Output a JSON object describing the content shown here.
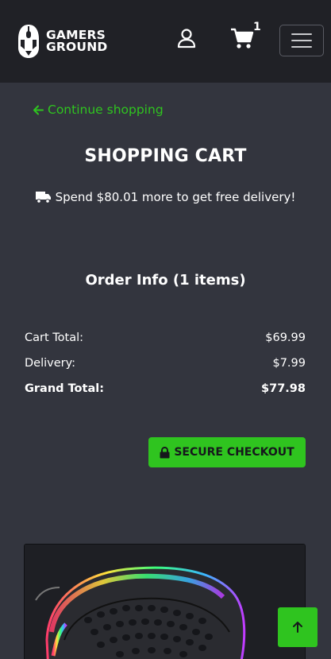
{
  "header": {
    "brand_line1": "GAMERS",
    "brand_line2": "GROUND",
    "cart_count": "1",
    "icons": [
      "mouse-logo-icon",
      "user-icon",
      "cart-icon",
      "hamburger-menu-icon"
    ]
  },
  "nav": {
    "continue_label": "Continue shopping"
  },
  "cart": {
    "title": "SHOPPING CART",
    "delivery_note": "Spend $80.01 more to get free delivery!",
    "order_info_title": "Order Info (1 items)",
    "summary": {
      "cart_total_label": "Cart Total:",
      "cart_total_value": "$69.99",
      "delivery_label": "Delivery:",
      "delivery_value": "$7.99",
      "grand_total_label": "Grand Total:",
      "grand_total_value": "$77.98"
    },
    "checkout_label": "SECURE CHECKOUT"
  },
  "colors": {
    "accent": "#2fc41f",
    "page_bg": "#33353e",
    "navbar_bg": "#202126"
  }
}
